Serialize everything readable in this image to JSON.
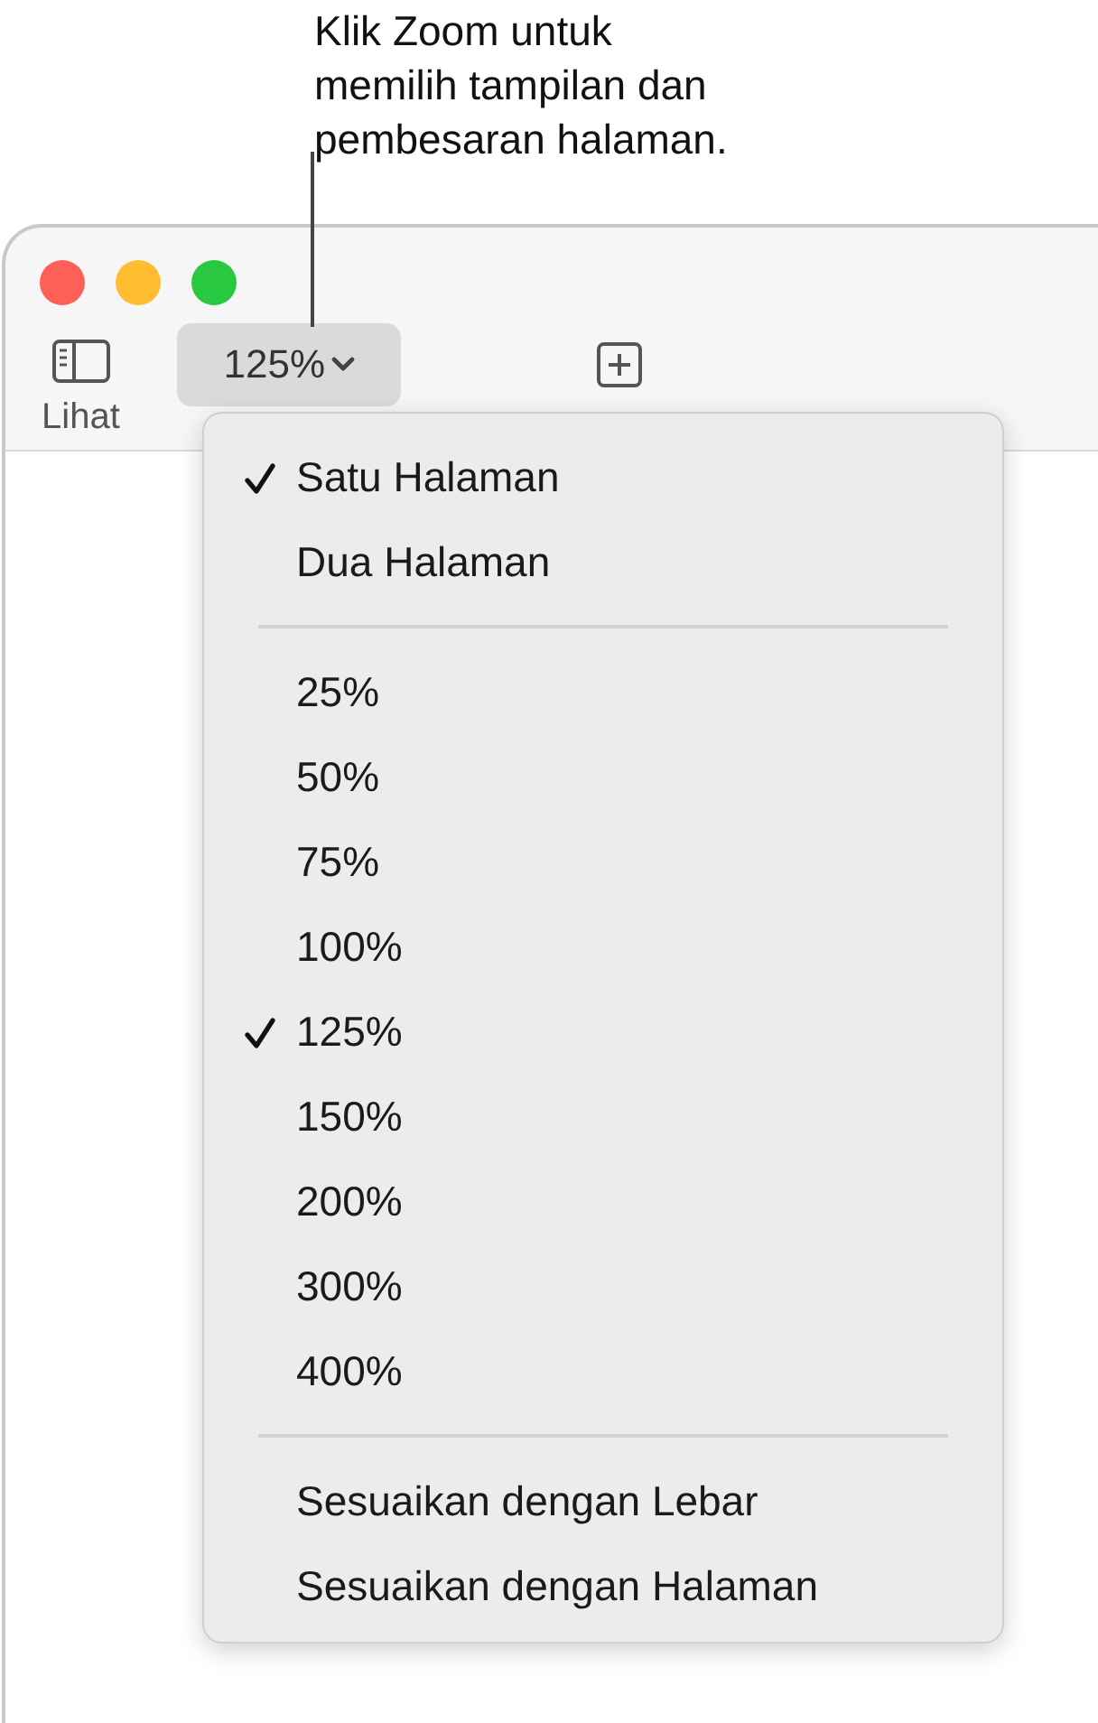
{
  "callout": "Klik Zoom untuk memilih tampilan dan pembesaran halaman.",
  "toolbar": {
    "view_label": "Lihat",
    "zoom_value": "125%"
  },
  "menu": {
    "items": [
      {
        "kind": "item",
        "label": "Satu Halaman",
        "checked": true
      },
      {
        "kind": "item",
        "label": "Dua Halaman",
        "checked": false
      },
      {
        "kind": "separator"
      },
      {
        "kind": "item",
        "label": "25%",
        "checked": false
      },
      {
        "kind": "item",
        "label": "50%",
        "checked": false
      },
      {
        "kind": "item",
        "label": "75%",
        "checked": false
      },
      {
        "kind": "item",
        "label": "100%",
        "checked": false
      },
      {
        "kind": "item",
        "label": "125%",
        "checked": true
      },
      {
        "kind": "item",
        "label": "150%",
        "checked": false
      },
      {
        "kind": "item",
        "label": "200%",
        "checked": false
      },
      {
        "kind": "item",
        "label": "300%",
        "checked": false
      },
      {
        "kind": "item",
        "label": "400%",
        "checked": false
      },
      {
        "kind": "separator"
      },
      {
        "kind": "item",
        "label": "Sesuaikan dengan Lebar",
        "checked": false
      },
      {
        "kind": "item",
        "label": "Sesuaikan dengan Halaman",
        "checked": false
      }
    ]
  }
}
